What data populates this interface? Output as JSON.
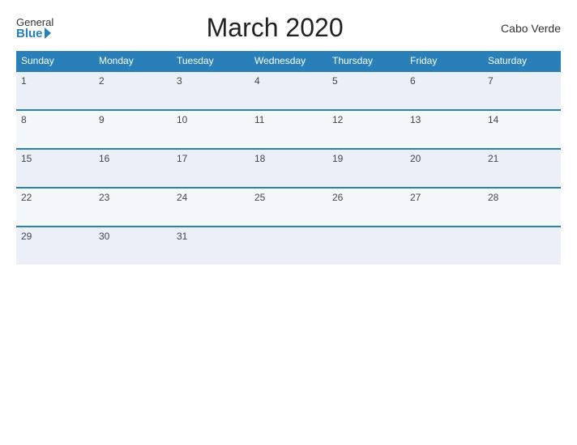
{
  "header": {
    "logo_general": "General",
    "logo_blue": "Blue",
    "title": "March 2020",
    "country": "Cabo Verde"
  },
  "weekdays": [
    "Sunday",
    "Monday",
    "Tuesday",
    "Wednesday",
    "Thursday",
    "Friday",
    "Saturday"
  ],
  "weeks": [
    [
      1,
      2,
      3,
      4,
      5,
      6,
      7
    ],
    [
      8,
      9,
      10,
      11,
      12,
      13,
      14
    ],
    [
      15,
      16,
      17,
      18,
      19,
      20,
      21
    ],
    [
      22,
      23,
      24,
      25,
      26,
      27,
      28
    ],
    [
      29,
      30,
      31,
      null,
      null,
      null,
      null
    ]
  ]
}
